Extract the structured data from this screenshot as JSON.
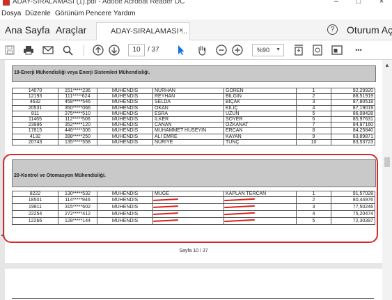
{
  "window": {
    "title": "ADAY-SIRALAMASI (1).pdf - Adobe Acrobat Reader DC",
    "minimize": "–",
    "maximize": "□",
    "close": "×"
  },
  "menu": [
    "Dosya",
    "Düzenle",
    "Görünüm",
    "Pencere",
    "Yardım"
  ],
  "tabbar": {
    "home": "Ana Sayfa",
    "tools": "Araçlar",
    "doc_tab": "ADAY-SIRALAMASI ...",
    "doc_tab_close": "×",
    "help": "?",
    "signin": "Oturum Aç"
  },
  "toolbar": {
    "page_current": "10",
    "page_total": "/ 37",
    "zoom": "%90",
    "more": "•••"
  },
  "colors": {
    "annotation": "#d62828",
    "redaction": "#e0201e",
    "section_header_bg": "#c9c9c9"
  },
  "section19": {
    "title": "19-Enerji Mühendisliği veya Enerji Sistemleri Mühendisliği.",
    "rows": [
      [
        "14070",
        "151*****236",
        "MÜHENDİS",
        "NURHAN",
        "GÖREN",
        "1",
        "92,29920"
      ],
      [
        "12193",
        "111*****624",
        "MÜHENDİS",
        "REYHAN",
        "BİLGİN",
        "2",
        "88,51919"
      ],
      [
        "4632",
        "458*****546",
        "MÜHENDİS",
        "SELDA",
        "BIÇAK",
        "3",
        "87,80518"
      ],
      [
        "20531",
        "350*****066",
        "MÜHENDİS",
        "OKAN",
        "KILIÇ",
        "4",
        "87,19019"
      ],
      [
        "811",
        "375*****510",
        "MÜHENDİS",
        "ESRA",
        "UZUN",
        "5",
        "86,08428"
      ],
      [
        "11465",
        "112*****506",
        "MÜHENDİS",
        "İLKER",
        "SOYER",
        "6",
        "85,97631"
      ],
      [
        "23986",
        "352*****120",
        "MÜHENDİS",
        "CANAN",
        "ÖZKANAT",
        "7",
        "84,87160"
      ],
      [
        "17815",
        "446*****306",
        "MÜHENDİS",
        "MUHAMMET HÜSEYİN",
        "ERCAN",
        "8",
        "84,25840"
      ],
      [
        "4132",
        "398*****250",
        "MÜHENDİS",
        "ALİ EMRE",
        "KAYAN",
        "9",
        "83,89871"
      ],
      [
        "20743",
        "135*****558",
        "MÜHENDİS",
        "NURİYE",
        "TUNÇ",
        "10",
        "83,53723"
      ]
    ]
  },
  "section20": {
    "title": "20-Kontrol ve Otomasyon Mühendisliği.",
    "rows": [
      [
        "8222",
        "130*****532",
        "MÜHENDİS",
        "MÜGE",
        "KAPLAN TERCAN",
        "1",
        "91,57028"
      ],
      [
        "18501",
        "114*****946",
        "MÜHENDİS",
        "",
        "",
        "2",
        "80,44976"
      ],
      [
        "19811",
        "315*****602",
        "MÜHENDİS",
        "",
        "",
        "3",
        "77,50246"
      ],
      [
        "22254",
        "272*****412",
        "MÜHENDİS",
        "",
        "",
        "4",
        "75,20474"
      ],
      [
        "12266",
        "128*****144",
        "MÜHENDİS",
        "",
        "",
        "5",
        "72,30397"
      ]
    ]
  },
  "page_footer": "Sayfa 10 / 37"
}
